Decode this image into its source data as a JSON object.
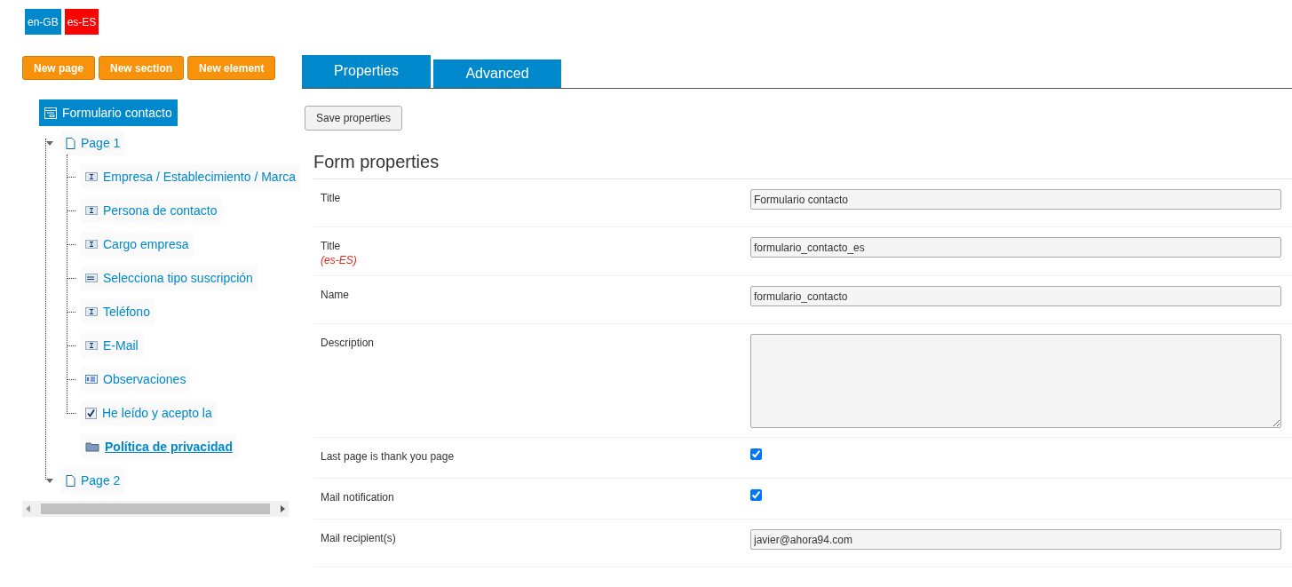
{
  "languages": [
    {
      "label": "en-GB",
      "color": "#0088cc"
    },
    {
      "label": "es-ES",
      "color": "#ff0000"
    }
  ],
  "toolbar": [
    "New page",
    "New section",
    "New element"
  ],
  "tree": {
    "label": "Formulario contacto",
    "selected": true,
    "children": [
      {
        "label": "Page 1",
        "expanded": true,
        "children": [
          {
            "label": "Empresa / Establecimiento / Marca",
            "kind": "text"
          },
          {
            "label": "Persona de contacto",
            "kind": "text"
          },
          {
            "label": "Cargo empresa",
            "kind": "text"
          },
          {
            "label": "Selecciona tipo suscripción",
            "kind": "select"
          },
          {
            "label": "Teléfono",
            "kind": "text"
          },
          {
            "label": "E-Mail",
            "kind": "text"
          },
          {
            "label": "Observaciones",
            "kind": "textarea"
          },
          {
            "label": "He leído y acepto la",
            "kind": "checkbox"
          },
          {
            "label": "Política de privacidad",
            "kind": "folder"
          }
        ]
      },
      {
        "label": "Page 2",
        "expanded": true
      }
    ]
  },
  "tabs": [
    {
      "label": "Properties",
      "selected": true
    },
    {
      "label": "Advanced",
      "selected": false
    }
  ],
  "save_button": "Save properties",
  "section_title": "Form properties",
  "fields": [
    {
      "label": "Title",
      "kind": "text",
      "value": "Formulario contacto"
    },
    {
      "label": "Title",
      "note": "(es-ES)",
      "kind": "text",
      "value": "formulario_contacto_es"
    },
    {
      "label": "Name",
      "kind": "text",
      "value": "formulario_contacto"
    },
    {
      "label": "Description",
      "kind": "textarea"
    },
    {
      "label": "Last page is thank you page",
      "kind": "checkbox",
      "checked": true
    },
    {
      "label": "Mail notification",
      "kind": "checkbox",
      "checked": true
    },
    {
      "label": "Mail recipient(s)",
      "kind": "text",
      "value": "javier@ahora94.com"
    }
  ]
}
